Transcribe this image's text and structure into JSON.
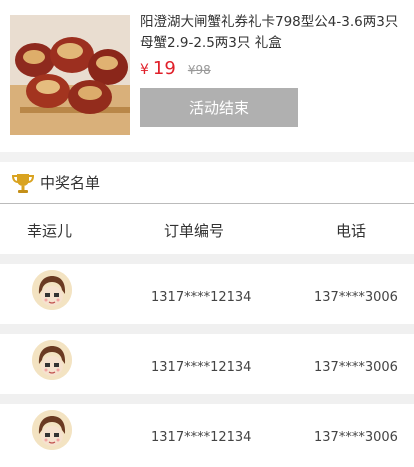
{
  "product": {
    "title": "阳澄湖大闸蟹礼券礼卡798型公4-3.6两3只母蟹2.9-2.5两3只 礼盒",
    "currency": "¥",
    "price": "19",
    "original_price": "¥98",
    "status_button": "活动结束",
    "image_icon": "red-dates-walnut-photo"
  },
  "winners": {
    "title": "中奖名单",
    "icon": "trophy-icon",
    "columns": [
      "幸运儿",
      "订单编号",
      "电话"
    ],
    "rows": [
      {
        "avatar": "cartoon-avatar",
        "order_no": "1317****12134",
        "phone": "137****3006"
      },
      {
        "avatar": "cartoon-avatar",
        "order_no": "1317****12134",
        "phone": "137****3006"
      },
      {
        "avatar": "cartoon-avatar",
        "order_no": "1317****12134",
        "phone": "137****3006"
      }
    ]
  },
  "colors": {
    "price": "#e0202a",
    "button_disabled": "#b0b0b0",
    "trophy": "#d9a320"
  }
}
